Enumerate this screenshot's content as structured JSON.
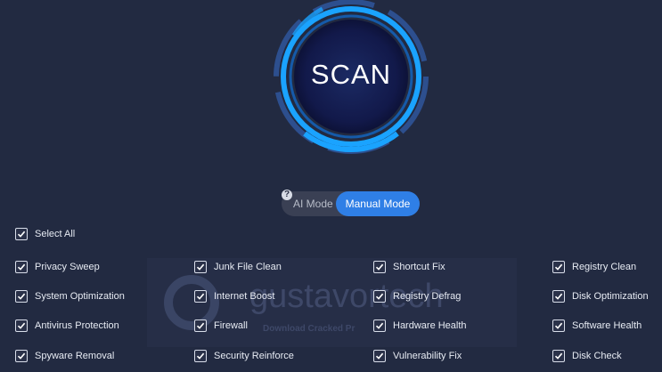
{
  "scan": {
    "label": "SCAN"
  },
  "modes": {
    "ai_label": "AI Mode",
    "manual_label": "Manual Mode",
    "active": "Manual Mode",
    "help_glyph": "?"
  },
  "select_all": {
    "label": "Select All",
    "checked": true
  },
  "watermark": {
    "text": "gustavortech",
    "subtitle": "Download Cracked Pr"
  },
  "options": [
    [
      {
        "label": "Privacy Sweep",
        "checked": true
      },
      {
        "label": "Junk File Clean",
        "checked": true
      },
      {
        "label": "Shortcut Fix",
        "checked": true
      },
      {
        "label": "Registry Clean",
        "checked": true
      }
    ],
    [
      {
        "label": "System Optimization",
        "checked": true
      },
      {
        "label": "Internet Boost",
        "checked": true
      },
      {
        "label": "Registry Defrag",
        "checked": true
      },
      {
        "label": "Disk Optimization",
        "checked": true
      }
    ],
    [
      {
        "label": "Antivirus Protection",
        "checked": true
      },
      {
        "label": "Firewall",
        "checked": true
      },
      {
        "label": "Hardware Health",
        "checked": true
      },
      {
        "label": "Software Health",
        "checked": true
      }
    ],
    [
      {
        "label": "Spyware Removal",
        "checked": true
      },
      {
        "label": "Security Reinforce",
        "checked": true
      },
      {
        "label": "Vulnerability Fix",
        "checked": true
      },
      {
        "label": "Disk Check",
        "checked": true
      }
    ]
  ],
  "colors": {
    "background": "#222a41",
    "accent": "#2f7fe6",
    "ring": "#1aa3ff"
  }
}
